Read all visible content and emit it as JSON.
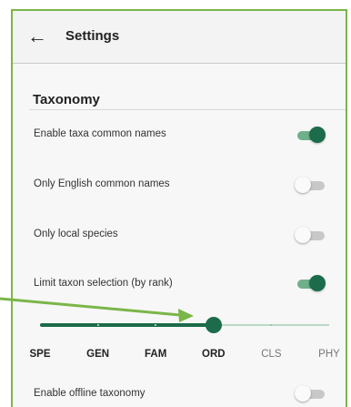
{
  "appbar": {
    "title": "Settings",
    "back_icon": "arrow-left-icon"
  },
  "section": {
    "title": "Taxonomy"
  },
  "settings": [
    {
      "label": "Enable taxa common names",
      "enabled": true
    },
    {
      "label": "Only English common names",
      "enabled": false
    },
    {
      "label": "Only local species",
      "enabled": false
    },
    {
      "label": "Limit taxon selection (by rank)",
      "enabled": true
    }
  ],
  "rank_slider": {
    "ranks": [
      "SPE",
      "GEN",
      "FAM",
      "ORD",
      "CLS",
      "PHY"
    ],
    "selected_index": 3
  },
  "offline": {
    "label": "Enable offline taxonomy",
    "enabled": false
  },
  "colors": {
    "accent": "#1c6b4a",
    "accent_light": "#6fb08a",
    "annotation": "#7ab648"
  }
}
